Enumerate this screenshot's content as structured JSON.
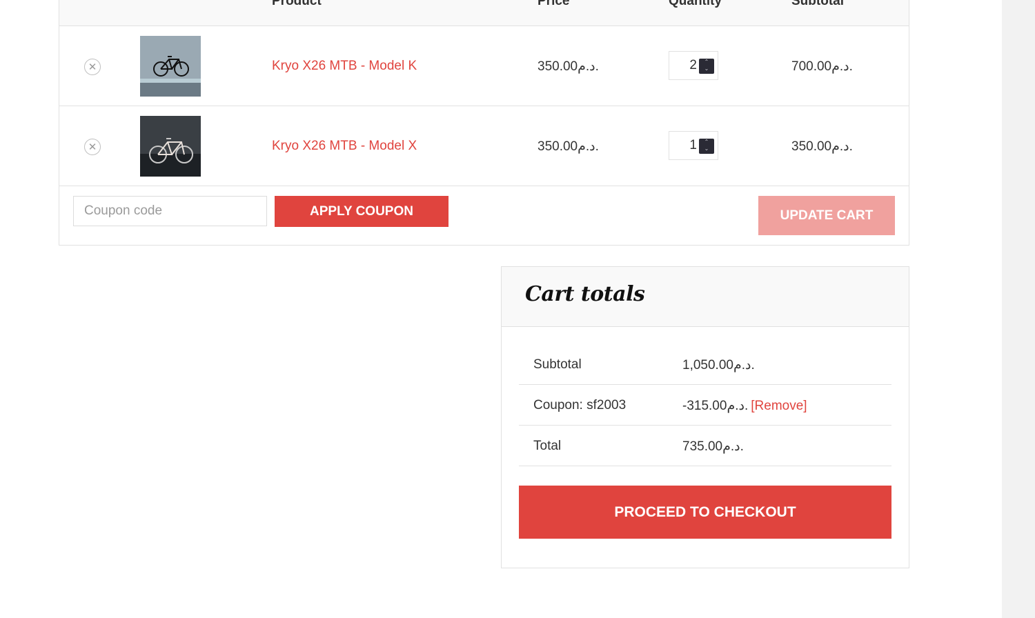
{
  "table": {
    "headers": {
      "product": "Product",
      "price": "Price",
      "quantity": "Quantity",
      "subtotal": "Subtotal"
    },
    "items": [
      {
        "name": "Kryo X26 MTB - Model K",
        "price": "350.00د.م.",
        "quantity": "2",
        "subtotal": "700.00د.م.",
        "remove_icon": "close-circle-icon"
      },
      {
        "name": "Kryo X26 MTB - Model X",
        "price": "350.00د.م.",
        "quantity": "1",
        "subtotal": "350.00د.م.",
        "remove_icon": "close-circle-icon"
      }
    ]
  },
  "actions": {
    "coupon_placeholder": "Coupon code",
    "apply_label": "Apply coupon",
    "update_label": "Update cart"
  },
  "totals": {
    "title": "Cart totals",
    "subtotal_label": "Subtotal",
    "subtotal_value": "1,050.00د.م.",
    "coupon_label": "Coupon: sf2003",
    "coupon_value": "-315.00د.م.",
    "coupon_remove": "[Remove]",
    "total_label": "Total",
    "total_value": "735.00د.م.",
    "checkout_label": "Proceed to checkout"
  },
  "colors": {
    "accent": "#e0443e",
    "accent_disabled": "#f0a19e",
    "border": "#e1e1e1",
    "header_bg": "#f9f9f9"
  }
}
